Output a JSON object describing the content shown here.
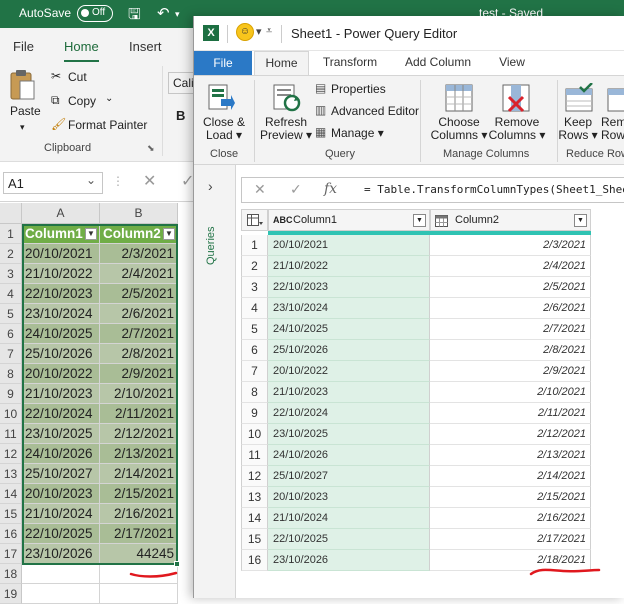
{
  "excel": {
    "titlebar": {
      "autosave_label": "AutoSave",
      "autosave_state": "Off",
      "doc_title": "test - Saved"
    },
    "tabs": [
      "File",
      "Home",
      "Insert"
    ],
    "ribbon": {
      "paste": "Paste",
      "cut": "Cut",
      "copy": "Copy",
      "format_painter": "Format Painter",
      "clipboard_group": "Clipboard",
      "font_partial": "Calil",
      "bold": "B"
    },
    "name_box": "A1",
    "columns": [
      "A",
      "B"
    ],
    "rows": [
      {
        "n": "1",
        "a": "Column1",
        "b": "Column2"
      },
      {
        "n": "2",
        "a": "20/10/2021",
        "b": "2/3/2021"
      },
      {
        "n": "3",
        "a": "21/10/2022",
        "b": "2/4/2021"
      },
      {
        "n": "4",
        "a": "22/10/2023",
        "b": "2/5/2021"
      },
      {
        "n": "5",
        "a": "23/10/2024",
        "b": "2/6/2021"
      },
      {
        "n": "6",
        "a": "24/10/2025",
        "b": "2/7/2021"
      },
      {
        "n": "7",
        "a": "25/10/2026",
        "b": "2/8/2021"
      },
      {
        "n": "8",
        "a": "20/10/2022",
        "b": "2/9/2021"
      },
      {
        "n": "9",
        "a": "21/10/2023",
        "b": "2/10/2021"
      },
      {
        "n": "10",
        "a": "22/10/2024",
        "b": "2/11/2021"
      },
      {
        "n": "11",
        "a": "23/10/2025",
        "b": "2/12/2021"
      },
      {
        "n": "12",
        "a": "24/10/2026",
        "b": "2/13/2021"
      },
      {
        "n": "13",
        "a": "25/10/2027",
        "b": "2/14/2021"
      },
      {
        "n": "14",
        "a": "20/10/2023",
        "b": "2/15/2021"
      },
      {
        "n": "15",
        "a": "21/10/2024",
        "b": "2/16/2021"
      },
      {
        "n": "16",
        "a": "22/10/2025",
        "b": "2/17/2021"
      },
      {
        "n": "17",
        "a": "23/10/2026",
        "b": "44245"
      },
      {
        "n": "18",
        "a": "",
        "b": ""
      },
      {
        "n": "19",
        "a": "",
        "b": ""
      }
    ]
  },
  "pq": {
    "window_title": "Sheet1 - Power Query Editor",
    "tabs": [
      "File",
      "Home",
      "Transform",
      "Add Column",
      "View"
    ],
    "ribbon": {
      "close_load": [
        "Close &",
        "Load ▾"
      ],
      "refresh_preview": [
        "Refresh",
        "Preview ▾"
      ],
      "properties": "Properties",
      "advanced_editor": "Advanced Editor",
      "manage": "Manage ▾",
      "choose_columns": [
        "Choose",
        "Columns ▾"
      ],
      "remove_columns": [
        "Remove",
        "Columns ▾"
      ],
      "keep_rows": [
        "Keep",
        "Rows ▾"
      ],
      "remove_rows_partial": [
        "Rem",
        "Row"
      ],
      "groups": [
        "Close",
        "Query",
        "Manage Columns",
        "Reduce Row"
      ]
    },
    "formula": "= Table.TransformColumnTypes(Sheet1_Shee",
    "queries_label": "Queries",
    "type_icon_col1": "ABC",
    "columns": [
      "Column1",
      "Column2"
    ],
    "rows": [
      {
        "n": "1",
        "c1": "20/10/2021",
        "c2": "2/3/2021"
      },
      {
        "n": "2",
        "c1": "21/10/2022",
        "c2": "2/4/2021"
      },
      {
        "n": "3",
        "c1": "22/10/2023",
        "c2": "2/5/2021"
      },
      {
        "n": "4",
        "c1": "23/10/2024",
        "c2": "2/6/2021"
      },
      {
        "n": "5",
        "c1": "24/10/2025",
        "c2": "2/7/2021"
      },
      {
        "n": "6",
        "c1": "25/10/2026",
        "c2": "2/8/2021"
      },
      {
        "n": "7",
        "c1": "20/10/2022",
        "c2": "2/9/2021"
      },
      {
        "n": "8",
        "c1": "21/10/2023",
        "c2": "2/10/2021"
      },
      {
        "n": "9",
        "c1": "22/10/2024",
        "c2": "2/11/2021"
      },
      {
        "n": "10",
        "c1": "23/10/2025",
        "c2": "2/12/2021"
      },
      {
        "n": "11",
        "c1": "24/10/2026",
        "c2": "2/13/2021"
      },
      {
        "n": "12",
        "c1": "25/10/2027",
        "c2": "2/14/2021"
      },
      {
        "n": "13",
        "c1": "20/10/2023",
        "c2": "2/15/2021"
      },
      {
        "n": "14",
        "c1": "21/10/2024",
        "c2": "2/16/2021"
      },
      {
        "n": "15",
        "c1": "22/10/2025",
        "c2": "2/17/2021"
      },
      {
        "n": "16",
        "c1": "23/10/2026",
        "c2": "2/18/2021"
      }
    ]
  },
  "colors": {
    "excel_green": "#217346",
    "table_header": "#70ad47",
    "pq_file_tab": "#2b79c6",
    "annotation_red": "#e0181e"
  }
}
